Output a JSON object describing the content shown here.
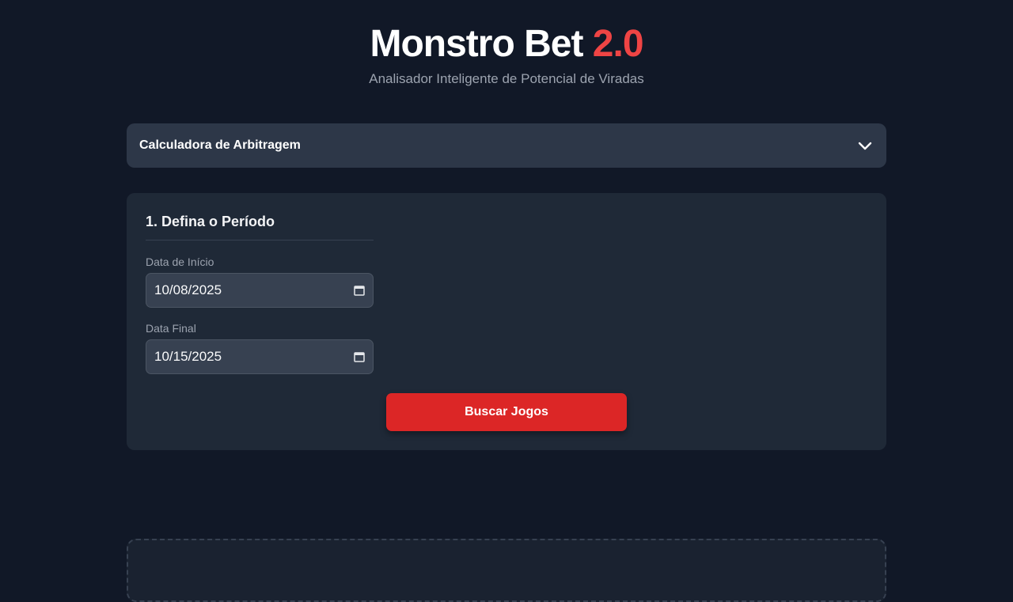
{
  "header": {
    "title_main": "Monstro Bet",
    "title_version": "2.0",
    "subtitle": "Analisador Inteligente de Potencial de Viradas"
  },
  "accordion": {
    "title": "Calculadora de Arbitragem",
    "icon": "chevron-down-icon",
    "expanded": false
  },
  "period": {
    "section_title": "1. Defina o Período",
    "start_date_label": "Data de Início",
    "start_date_value": "10/08/2025",
    "end_date_label": "Data Final",
    "end_date_value": "10/15/2025",
    "calendar_icon": "calendar-icon",
    "search_button_label": "Buscar Jogos"
  },
  "colors": {
    "background": "#111827",
    "card": "#1f2937",
    "accent": "#ef4444",
    "button": "#dc2626"
  }
}
